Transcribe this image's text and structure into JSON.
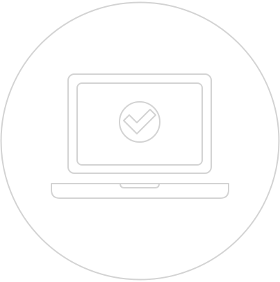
{
  "illustration": {
    "icon": "laptop-check-icon",
    "stroke_color": "#d3d3d3",
    "background_color": "#ffffff"
  }
}
